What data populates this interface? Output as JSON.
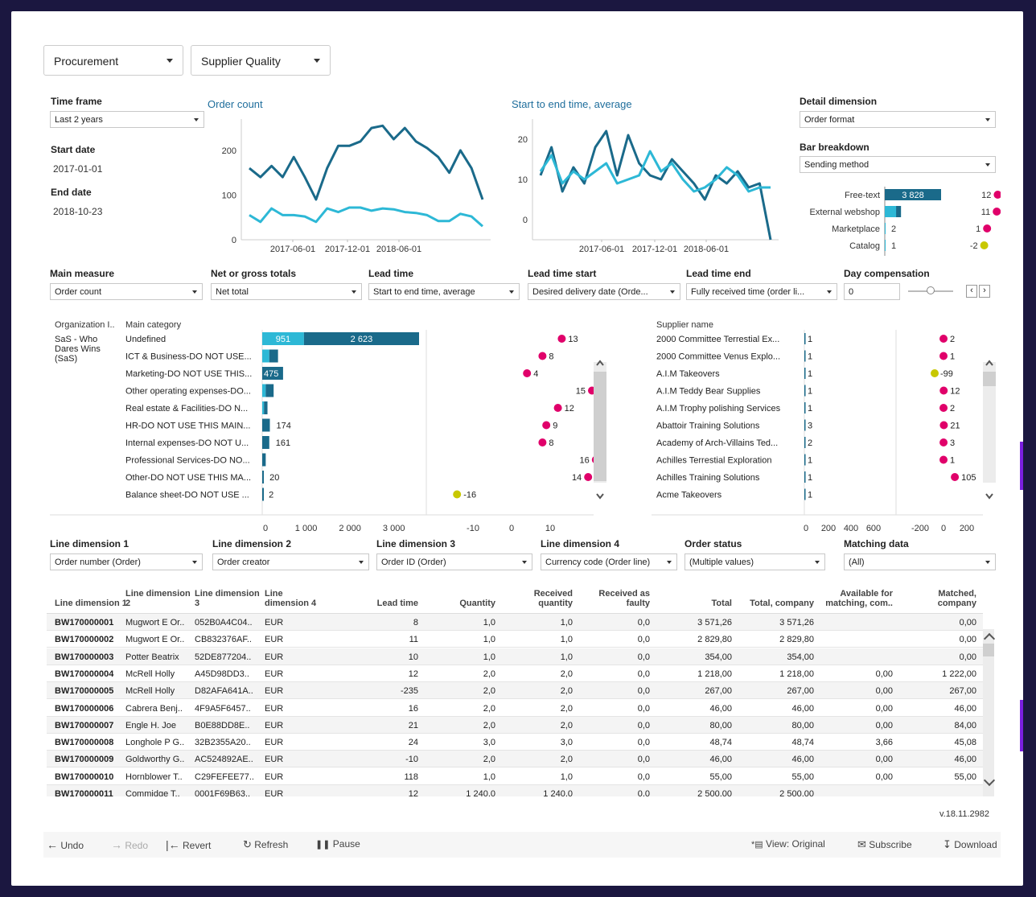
{
  "top_dropdowns": [
    "Procurement",
    "Supplier Quality"
  ],
  "time_frame": {
    "label": "Time frame",
    "value": "Last 2 years"
  },
  "start_date": {
    "label": "Start date",
    "value": "2017-01-01"
  },
  "end_date": {
    "label": "End date",
    "value": "2018-10-23"
  },
  "detail_dimension": {
    "label": "Detail dimension",
    "value": "Order format"
  },
  "bar_breakdown": {
    "label": "Bar breakdown",
    "value": "Sending method"
  },
  "breakdown_rows": [
    {
      "label": "Free-text",
      "bar_label": "3 828",
      "bar_value": 3828,
      "dot_label": "12",
      "dot_value": 12,
      "dot_color": "#e0006a"
    },
    {
      "label": "External webshop",
      "bar_label": "",
      "bar_value": 1100,
      "dot_label": "11",
      "dot_value": 11,
      "dot_color": "#e0006a"
    },
    {
      "label": "Marketplace",
      "bar_label": "2",
      "bar_value": 2,
      "dot_label": "1",
      "dot_value": 1,
      "dot_color": "#e0006a"
    },
    {
      "label": "Catalog",
      "bar_label": "1",
      "bar_value": 1,
      "dot_label": "-2",
      "dot_value": -2,
      "dot_color": "#c8c800"
    }
  ],
  "chart_data": [
    {
      "type": "line",
      "title": "Order count",
      "x_ticks": [
        "2017-06-01",
        "2017-12-01",
        "2018-06-01"
      ],
      "y_ticks": [
        "0",
        "100",
        "200"
      ],
      "ylim": [
        0,
        270
      ],
      "series": [
        {
          "color": "#1a6a8a",
          "values": [
            160,
            140,
            165,
            140,
            185,
            140,
            90,
            160,
            210,
            210,
            220,
            250,
            255,
            225,
            250,
            220,
            205,
            185,
            150,
            200,
            160,
            90
          ]
        },
        {
          "color": "#2db8d6",
          "values": [
            55,
            40,
            70,
            55,
            55,
            52,
            40,
            70,
            62,
            72,
            72,
            65,
            70,
            68,
            62,
            60,
            55,
            42,
            42,
            58,
            52,
            30
          ]
        }
      ]
    },
    {
      "type": "line",
      "title": "Start to end time, average",
      "x_ticks": [
        "2017-06-01",
        "2017-12-01",
        "2018-06-01"
      ],
      "y_ticks": [
        "0",
        "10",
        "20"
      ],
      "ylim": [
        -5,
        25
      ],
      "series": [
        {
          "color": "#1a6a8a",
          "values": [
            11,
            18,
            7,
            13,
            9,
            18,
            22,
            11,
            21,
            14,
            11,
            10,
            15,
            12,
            9,
            5,
            11,
            9,
            12,
            8,
            9,
            -5
          ]
        },
        {
          "color": "#2db8d6",
          "values": [
            12,
            16,
            9,
            12,
            10,
            12,
            14,
            9,
            10,
            11,
            17,
            12,
            14,
            10,
            7,
            8,
            10,
            13,
            11,
            7,
            8,
            8
          ]
        }
      ]
    }
  ],
  "measures": [
    {
      "label": "Main measure",
      "value": "Order count"
    },
    {
      "label": "Net or gross totals",
      "value": "Net total"
    },
    {
      "label": "Lead time",
      "value": "Start to end time, average"
    },
    {
      "label": "Lead time start",
      "value": "Desired delivery date (Orde..."
    },
    {
      "label": "Lead time end",
      "value": "Fully received time (order li..."
    },
    {
      "label": "Day compensation",
      "value": "0"
    }
  ],
  "left_panel": {
    "col1": "Organization I..",
    "col2": "Main category",
    "org": "SaS - Who Dares Wins (SaS)",
    "rows": [
      {
        "cat": "Undefined",
        "a": 951,
        "b": 2623,
        "la": "951",
        "lb": "2 623",
        "dot": 13,
        "dl": "13",
        "dc": "#e0006a"
      },
      {
        "cat": "ICT & Business-DO NOT USE...",
        "a": 160,
        "b": 200,
        "la": "",
        "lb": "",
        "dot": 8,
        "dl": "8",
        "dc": "#e0006a"
      },
      {
        "cat": "Marketing-DO NOT USE THIS...",
        "a": 0,
        "b": 475,
        "la": "475",
        "lb": "",
        "dot": 4,
        "dl": "4",
        "dc": "#e0006a"
      },
      {
        "cat": "Other operating expenses-DO...",
        "a": 80,
        "b": 180,
        "la": "",
        "lb": "",
        "dot": 15,
        "dl": "15",
        "dc": "#e0006a"
      },
      {
        "cat": "Real estate & Facilities-DO N...",
        "a": 40,
        "b": 80,
        "la": "",
        "lb": "",
        "dot": 12,
        "dl": "12",
        "dc": "#e0006a"
      },
      {
        "cat": "HR-DO NOT USE THIS MAIN...",
        "a": 0,
        "b": 174,
        "la": "174",
        "lb": "",
        "dot": 9,
        "dl": "9",
        "dc": "#e0006a"
      },
      {
        "cat": "Internal expenses-DO NOT U...",
        "a": 0,
        "b": 161,
        "la": "161",
        "lb": "",
        "dot": 8,
        "dl": "8",
        "dc": "#e0006a"
      },
      {
        "cat": "Professional Services-DO NO...",
        "a": 0,
        "b": 80,
        "la": "",
        "lb": "",
        "dot": 16,
        "dl": "16",
        "dc": "#e0006a"
      },
      {
        "cat": "Other-DO NOT USE THIS MA...",
        "a": 0,
        "b": 20,
        "la": "20",
        "lb": "",
        "dot": 14,
        "dl": "14",
        "dc": "#e0006a"
      },
      {
        "cat": "Balance sheet-DO NOT USE ...",
        "a": 0,
        "b": 2,
        "la": "2",
        "lb": "",
        "dot": -16,
        "dl": "-16",
        "dc": "#c8c800"
      }
    ],
    "bar_ticks": [
      "0",
      "1 000",
      "2 000",
      "3 000"
    ],
    "dot_ticks": [
      "-10",
      "0",
      "10"
    ]
  },
  "right_panel": {
    "col1": "Supplier name",
    "rows": [
      {
        "name": "2000 Committee Terrestial Ex...",
        "v": "1",
        "dot": 2,
        "dl": "2",
        "dc": "#e0006a"
      },
      {
        "name": "2000 Committee Venus Explo...",
        "v": "1",
        "dot": 1,
        "dl": "1",
        "dc": "#e0006a"
      },
      {
        "name": "A.I.M Takeovers",
        "v": "1",
        "dot": -99,
        "dl": "-99",
        "dc": "#c8c800"
      },
      {
        "name": "A.I.M Teddy Bear Supplies",
        "v": "1",
        "dot": 12,
        "dl": "12",
        "dc": "#e0006a"
      },
      {
        "name": "A.I.M Trophy polishing Services",
        "v": "1",
        "dot": 2,
        "dl": "2",
        "dc": "#e0006a"
      },
      {
        "name": "Abattoir Training Solutions",
        "v": "3",
        "dot": 21,
        "dl": "21",
        "dc": "#e0006a"
      },
      {
        "name": "Academy of Arch-Villains Ted...",
        "v": "2",
        "dot": 3,
        "dl": "3",
        "dc": "#e0006a"
      },
      {
        "name": "Achilles Terrestial Exploration",
        "v": "1",
        "dot": 1,
        "dl": "1",
        "dc": "#e0006a"
      },
      {
        "name": "Achilles Training Solutions",
        "v": "1",
        "dot": 105,
        "dl": "105",
        "dc": "#e0006a"
      },
      {
        "name": "Acme Takeovers",
        "v": "1",
        "dot": null,
        "dl": "",
        "dc": "#e0006a"
      }
    ],
    "bar_ticks": [
      "0",
      "200",
      "400",
      "600"
    ],
    "dot_ticks": [
      "-200",
      "0",
      "200"
    ]
  },
  "line_filters": [
    {
      "label": "Line dimension 1",
      "value": "Order number (Order)"
    },
    {
      "label": "Line dimension 2",
      "value": "Order creator"
    },
    {
      "label": "Line dimension 3",
      "value": "Order ID (Order)"
    },
    {
      "label": "Line dimension 4",
      "value": "Currency code (Order line)"
    },
    {
      "label": "Order status",
      "value": "(Multiple values)"
    },
    {
      "label": "Matching data",
      "value": "(All)"
    }
  ],
  "table": {
    "headers": [
      "Line dimension 1",
      "Line dimension 2",
      "Line dimension 3",
      "Line dimension 4",
      "Lead time",
      "Quantity",
      "Received quantity",
      "Received as faulty",
      "Total",
      "Total, company",
      "Available for matching, com..",
      "Matched, company"
    ],
    "rows": [
      [
        "BW170000001",
        "Mugwort E Or..",
        "052B0A4C04..",
        "EUR",
        "8",
        "1,0",
        "1,0",
        "0,0",
        "3 571,26",
        "3 571,26",
        "",
        "0,00"
      ],
      [
        "BW170000002",
        "Mugwort E Or..",
        "CB832376AF..",
        "EUR",
        "11",
        "1,0",
        "1,0",
        "0,0",
        "2 829,80",
        "2 829,80",
        "",
        "0,00"
      ],
      [
        "BW170000003",
        "Potter Beatrix",
        "52DE877204..",
        "EUR",
        "10",
        "1,0",
        "1,0",
        "0,0",
        "354,00",
        "354,00",
        "",
        "0,00"
      ],
      [
        "BW170000004",
        "McRell Holly",
        "A45D98DD3..",
        "EUR",
        "12",
        "2,0",
        "2,0",
        "0,0",
        "1 218,00",
        "1 218,00",
        "0,00",
        "1 222,00"
      ],
      [
        "BW170000005",
        "McRell Holly",
        "D82AFA641A..",
        "EUR",
        "-235",
        "2,0",
        "2,0",
        "0,0",
        "267,00",
        "267,00",
        "0,00",
        "267,00"
      ],
      [
        "BW170000006",
        "Cabrera Benj..",
        "4F9A5F6457..",
        "EUR",
        "16",
        "2,0",
        "2,0",
        "0,0",
        "46,00",
        "46,00",
        "0,00",
        "46,00"
      ],
      [
        "BW170000007",
        "Engle H. Joe",
        "B0E88DD8E..",
        "EUR",
        "21",
        "2,0",
        "2,0",
        "0,0",
        "80,00",
        "80,00",
        "0,00",
        "84,00"
      ],
      [
        "BW170000008",
        "Longhole P G..",
        "32B2355A20..",
        "EUR",
        "24",
        "3,0",
        "3,0",
        "0,0",
        "48,74",
        "48,74",
        "3,66",
        "45,08"
      ],
      [
        "BW170000009",
        "Goldworthy G..",
        "AC524892AE..",
        "EUR",
        "-10",
        "2,0",
        "2,0",
        "0,0",
        "46,00",
        "46,00",
        "0,00",
        "46,00"
      ],
      [
        "BW170000010",
        "Hornblower T..",
        "C29FEFEE77..",
        "EUR",
        "118",
        "1,0",
        "1,0",
        "0,0",
        "55,00",
        "55,00",
        "0,00",
        "55,00"
      ],
      [
        "BW170000011",
        "Commidge T..",
        "0001F69B63..",
        "EUR",
        "12",
        "1 240,0",
        "1 240,0",
        "0,0",
        "2 500,00",
        "2 500,00",
        "",
        ""
      ]
    ]
  },
  "version": "v.18.11.2982",
  "toolbar": {
    "undo": "Undo",
    "redo": "Redo",
    "revert": "Revert",
    "refresh": "Refresh",
    "pause": "Pause",
    "view": "View: Original",
    "subscribe": "Subscribe",
    "download": "Download"
  }
}
